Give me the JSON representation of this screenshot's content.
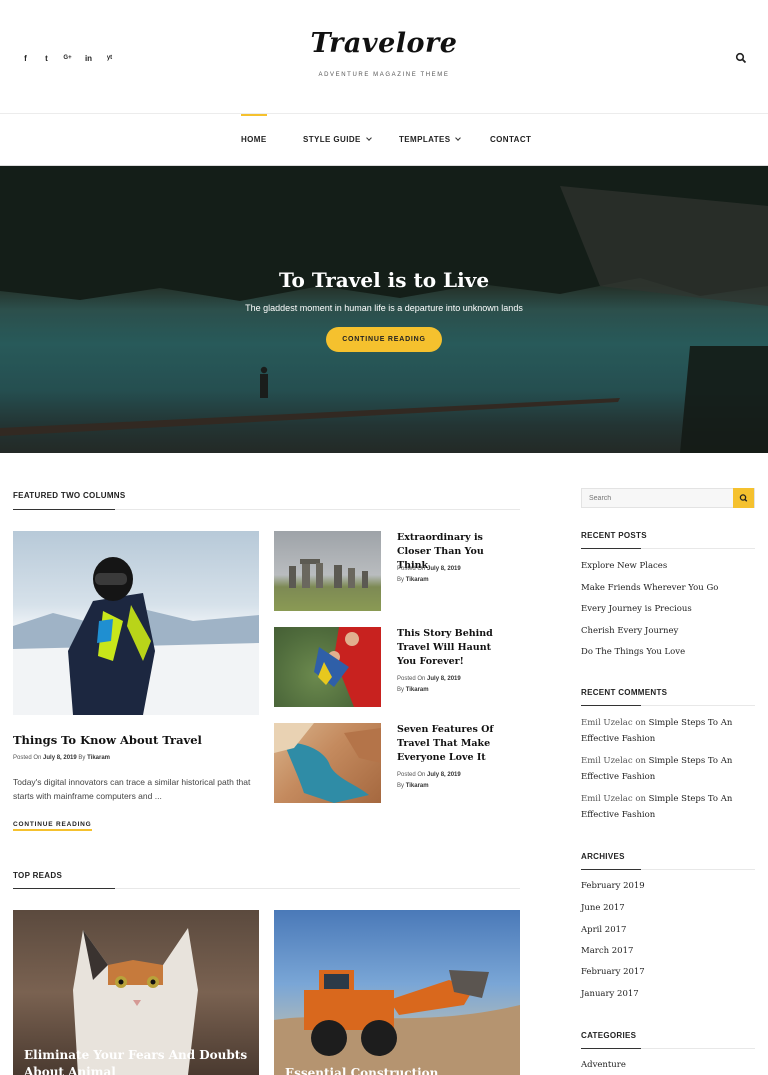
{
  "header": {
    "social": [
      "f",
      "t",
      "G+",
      "in",
      "yt"
    ],
    "logo": "Travelore",
    "tagline": "ADVENTURE MAGAZINE THEME"
  },
  "nav": {
    "items": [
      {
        "label": "HOME"
      },
      {
        "label": "STYLE GUIDE"
      },
      {
        "label": "TEMPLATES"
      },
      {
        "label": "CONTACT"
      }
    ]
  },
  "hero": {
    "title": "To Travel is to Live",
    "subtitle": "The gladdest moment in human life is a departure into unknown lands",
    "button": "CONTINUE READING"
  },
  "featured": {
    "section_title": "FEATURED TWO COLUMNS",
    "main": {
      "title": "Things To Know About Travel",
      "posted_prefix": "Posted On",
      "date": "July 8, 2019",
      "by_prefix": "By",
      "author": "Tikaram",
      "excerpt": "Today's digital innovators can trace a similar historical path that starts with mainframe computers and ...",
      "more": "CONTINUE READING"
    },
    "side": [
      {
        "title": "Extraordinary is Closer Than You Think",
        "posted_prefix": "Posted On",
        "date": "July 8, 2019",
        "by_prefix": "By",
        "author": "Tikaram"
      },
      {
        "title": "This Story Behind Travel Will Haunt You Forever!",
        "posted_prefix": "Posted On",
        "date": "July 8, 2019",
        "by_prefix": "By",
        "author": "Tikaram"
      },
      {
        "title": "Seven Features Of Travel That Make Everyone Love It",
        "posted_prefix": "Posted On",
        "date": "July 8, 2019",
        "by_prefix": "By",
        "author": "Tikaram"
      }
    ]
  },
  "top_reads": {
    "section_title": "TOP READS",
    "items": [
      {
        "title": "Eliminate Your Fears And Doubts About Animal"
      },
      {
        "title": "Essential Construction Smartphone Apps"
      }
    ]
  },
  "sidebar": {
    "search_placeholder": "Search",
    "recent_posts": {
      "title": "RECENT POSTS",
      "items": [
        "Explore New Places",
        "Make Friends Wherever You Go",
        "Every Journey is Precious",
        "Cherish Every Journey",
        "Do The Things You Love"
      ]
    },
    "recent_comments": {
      "title": "RECENT COMMENTS",
      "items": [
        {
          "author": "Emil Uzelac",
          "on": "on",
          "post": "Simple Steps To An Effective Fashion"
        },
        {
          "author": "Emil Uzelac",
          "on": "on",
          "post": "Simple Steps To An Effective Fashion"
        },
        {
          "author": "Emil Uzelac",
          "on": "on",
          "post": "Simple Steps To An Effective Fashion"
        }
      ]
    },
    "archives": {
      "title": "ARCHIVES",
      "items": [
        "February 2019",
        "June 2017",
        "April 2017",
        "March 2017",
        "February 2017",
        "January 2017"
      ]
    },
    "categories": {
      "title": "CATEGORIES",
      "items": [
        "Adventure"
      ]
    }
  },
  "colors": {
    "accent": "#f5c12e",
    "text": "#222222",
    "rule": "#e8e8e8"
  },
  "icons": [
    "facebook-icon",
    "twitter-icon",
    "google-plus-icon",
    "linkedin-icon",
    "youtube-icon",
    "search-icon",
    "chevron-down-icon"
  ]
}
